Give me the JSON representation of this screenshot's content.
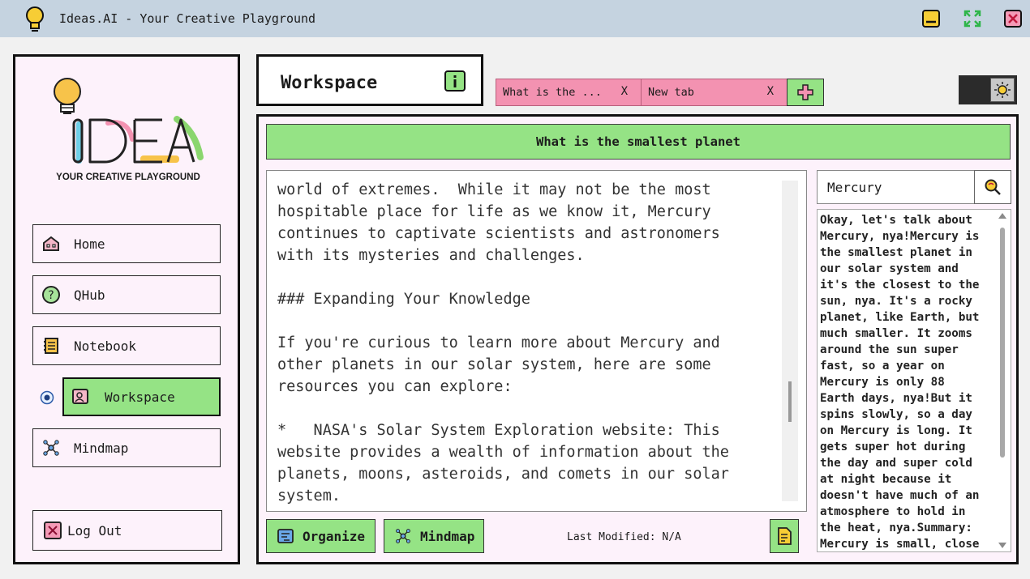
{
  "window": {
    "title": "Ideas.AI - Your Creative Playground",
    "app_icon": "lightbulb-icon",
    "controls": [
      "minimize-icon",
      "maximize-icon",
      "close-icon"
    ]
  },
  "sidebar": {
    "logo_text": "IDEA",
    "logo_tagline": "YOUR CREATIVE PLAYGROUND",
    "items": [
      {
        "label": "Home",
        "icon": "home-icon"
      },
      {
        "label": "QHub",
        "icon": "question-icon"
      },
      {
        "label": "Notebook",
        "icon": "notebook-icon"
      },
      {
        "label": "Workspace",
        "icon": "workspace-icon",
        "active": true
      },
      {
        "label": "Mindmap",
        "icon": "mindmap-icon"
      }
    ],
    "logout_label": "Log Out"
  },
  "workspace": {
    "title": "Workspace",
    "tabs": [
      {
        "label": "What is the ...",
        "close": "X"
      },
      {
        "label": "New tab",
        "close": "X"
      }
    ],
    "question": "What is the smallest planet",
    "editor_text": "world of extremes.  While it may not be the most\nhospitable place for life as we know it, Mercury\ncontinues to captivate scientists and astronomers\nwith its mysteries and challenges.\n\n### Expanding Your Knowledge\n\nIf you're curious to learn more about Mercury and\nother planets in our solar system, here are some\nresources you can explore:\n\n*   NASA's Solar System Exploration website: This\nwebsite provides a wealth of information about the\nplanets, moons, asteroids, and comets in our solar\nsystem.",
    "search_value": "Mercury",
    "side_answer": "Okay, let's talk about\nMercury, nya!Mercury is\nthe smallest planet in\nour solar system and\nit's the closest to the\nsun, nya. It's a rocky\nplanet, like Earth, but\nmuch smaller. It zooms\naround the sun super\nfast, so a year on\nMercury is only 88\nEarth days, nya!But it\nspins slowly, so a day\non Mercury is long. It\ngets super hot during\nthe day and super cold\nat night because it\ndoesn't have much of an\natmosphere to hold in\nthe heat, nya.Summary:\nMercury is small, close",
    "organize_label": "Organize",
    "mindmap_label": "Mindmap",
    "last_modified": "Last Modified: N/A"
  },
  "colors": {
    "accent_green": "#95e385",
    "tab_pink": "#f392b1",
    "sidebar_bg": "#fdf2fb",
    "titlebar_bg": "#c5d3e0"
  }
}
